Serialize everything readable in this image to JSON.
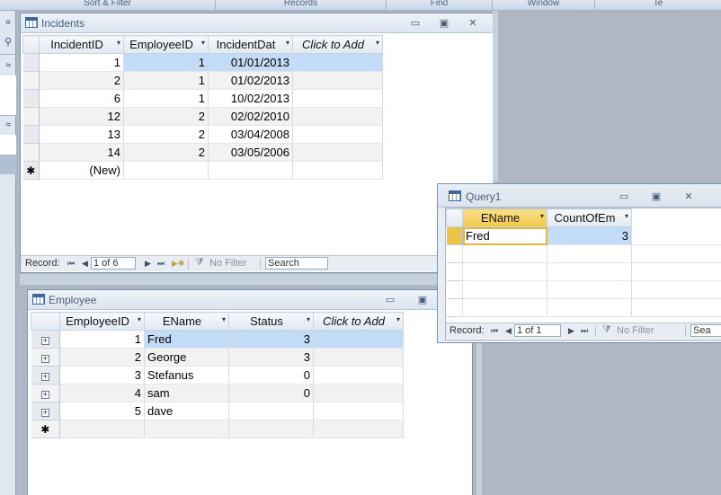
{
  "ribbon": {
    "groups": [
      "Sort & Filter",
      "Records",
      "Find",
      "Window",
      "Te"
    ]
  },
  "incidents": {
    "title": "Incidents",
    "columns": [
      "IncidentID",
      "EmployeeID",
      "IncidentDat",
      "Click to Add"
    ],
    "rows": [
      [
        "1",
        "1",
        "01/01/2013"
      ],
      [
        "2",
        "1",
        "01/02/2013"
      ],
      [
        "6",
        "1",
        "10/02/2013"
      ],
      [
        "12",
        "2",
        "02/02/2010"
      ],
      [
        "13",
        "2",
        "03/04/2008"
      ],
      [
        "14",
        "2",
        "03/05/2006"
      ]
    ],
    "new_row": "(New)",
    "new_marker": "✱",
    "nav": {
      "label": "Record:",
      "current": "1 of 6",
      "filter": "No Filter",
      "search": "Search"
    }
  },
  "employee": {
    "title": "Employee",
    "columns": [
      "EmployeeID",
      "EName",
      "Status",
      "Click to Add"
    ],
    "rows": [
      [
        "1",
        "Fred",
        "3"
      ],
      [
        "2",
        "George",
        "3"
      ],
      [
        "3",
        "Stefanus",
        "0"
      ],
      [
        "4",
        "sam",
        "0"
      ],
      [
        "5",
        "dave",
        ""
      ]
    ],
    "new_marker": "✱"
  },
  "query": {
    "title": "Query1",
    "columns": [
      "EName",
      "CountOfEm"
    ],
    "rows": [
      [
        "Fred",
        "3"
      ]
    ],
    "nav": {
      "label": "Record:",
      "current": "1 of 1",
      "filter": "No Filter",
      "search": "Sea"
    }
  },
  "icons": {
    "first": "⏮",
    "prev": "◀",
    "next": "▶",
    "last": "⏭",
    "new": "▶✱",
    "filter": "funnel-icon",
    "plus": "+",
    "dropdown": "▾",
    "minimize": "▭",
    "maximize": "▣",
    "close": "✕",
    "collapse": "«",
    "search": "⚲",
    "chevrons": "≈"
  }
}
